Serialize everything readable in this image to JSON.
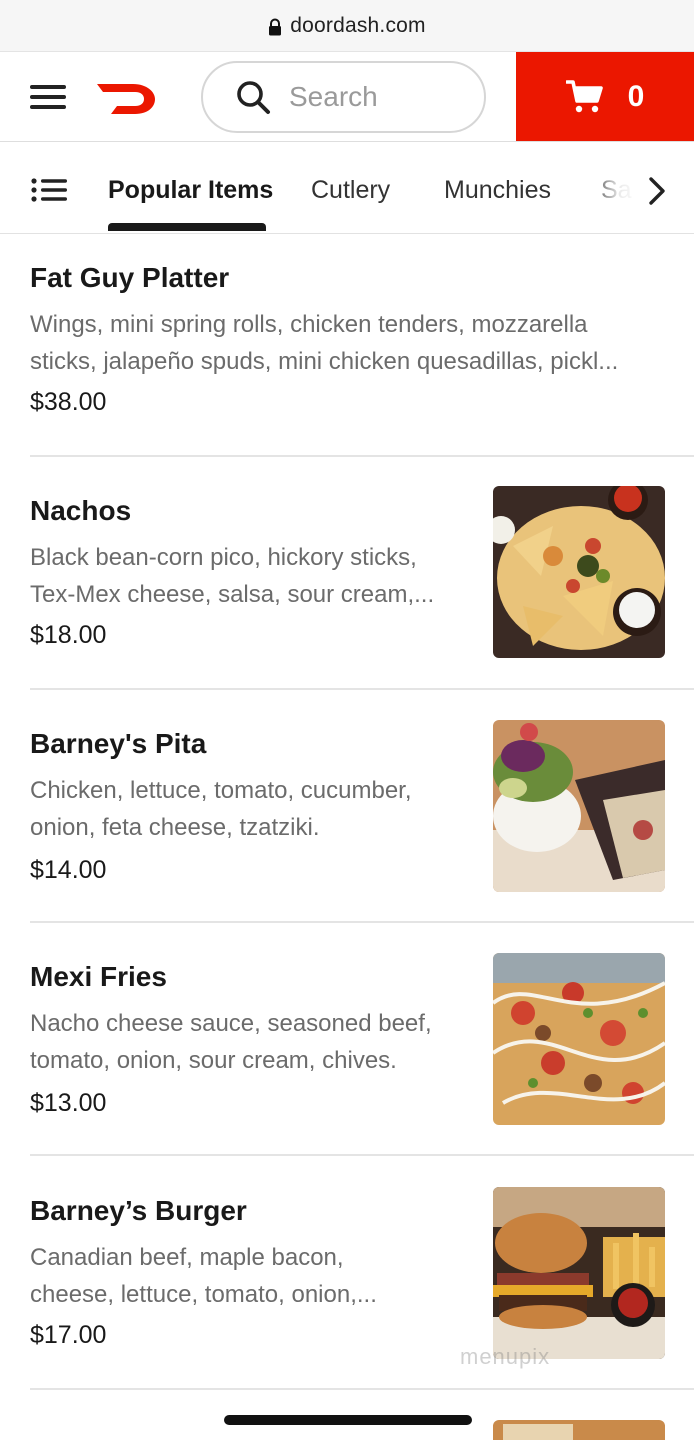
{
  "browser": {
    "domain": "doordash.com"
  },
  "header": {
    "search_placeholder": "Search",
    "cart_count": "0",
    "brand_color": "#eb1700"
  },
  "tabs": [
    {
      "label": "Popular Items",
      "active": true
    },
    {
      "label": "Cutlery",
      "active": false
    },
    {
      "label": "Munchies",
      "active": false
    },
    {
      "label": "Sa",
      "active": false
    }
  ],
  "items": [
    {
      "name": "Fat Guy Platter",
      "desc_lines": [
        "Wings, mini spring rolls, chicken tenders, mozzarella",
        "sticks, jalapeño spuds, mini chicken quesadillas, pickl..."
      ],
      "price": "$38.00",
      "image": null
    },
    {
      "name": "Nachos",
      "desc_lines": [
        "Black bean-corn pico, hickory sticks,",
        "Tex-Mex cheese, salsa, sour cream,..."
      ],
      "price": "$18.00",
      "image": "nachos-photo"
    },
    {
      "name": "Barney's Pita",
      "desc_lines": [
        "Chicken, lettuce, tomato, cucumber,",
        "onion, feta cheese, tzatziki."
      ],
      "price": "$14.00",
      "image": "pita-photo"
    },
    {
      "name": "Mexi Fries",
      "desc_lines": [
        "Nacho cheese sauce, seasoned beef,",
        "tomato, onion, sour cream, chives."
      ],
      "price": "$13.00",
      "image": "fries-photo"
    },
    {
      "name": "Barney’s Burger",
      "desc_lines": [
        "Canadian beef, maple bacon,",
        "cheese, lettuce, tomato, onion,..."
      ],
      "price": "$17.00",
      "image": "burger-photo"
    }
  ],
  "watermark": "menupix"
}
